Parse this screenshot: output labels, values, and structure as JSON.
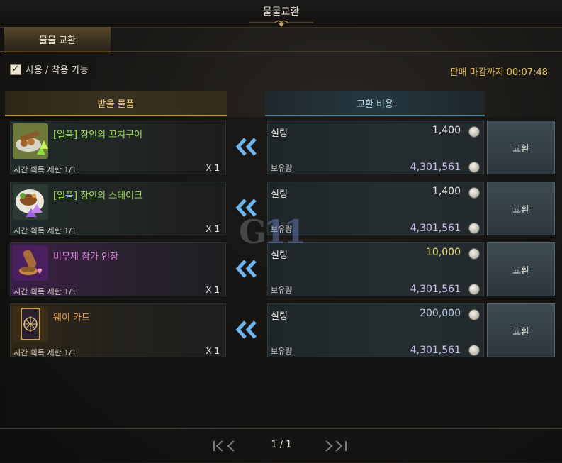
{
  "window": {
    "title": "물물교환"
  },
  "tabs": [
    {
      "label": "물물 교환",
      "active": true
    }
  ],
  "filter": {
    "label": "사용 / 착용 가능",
    "checked": true
  },
  "deadline": {
    "label": "판매 마감까지",
    "value": "00:07:48"
  },
  "columns": {
    "receive": "받을 물품",
    "cost": "교환 비용"
  },
  "rows": [
    {
      "item_name": "[일품] 장인의 꼬치구이",
      "name_color": "green",
      "icon": "skewer-food-icon",
      "limit": "시간 획득 제한 1/1",
      "qty": "X 1",
      "currency": "실링",
      "price": "1,400",
      "price_color": "white",
      "own_label": "보유량",
      "own": "4,301,561",
      "button": "교환"
    },
    {
      "item_name": "[일품] 장인의 스테이크",
      "name_color": "green",
      "icon": "steak-plate-icon",
      "limit": "시간 획득 제한 1/1",
      "qty": "X 1",
      "currency": "실링",
      "price": "1,400",
      "price_color": "white",
      "own_label": "보유량",
      "own": "4,301,561",
      "button": "교환"
    },
    {
      "item_name": "비무제 참가 인장",
      "name_color": "pink",
      "icon": "wax-seal-icon",
      "limit": "시간 획득 제한 1/1",
      "qty": "X 1",
      "currency": "실링",
      "price": "10,000",
      "price_color": "yellow",
      "own_label": "보유량",
      "own": "4,301,561",
      "button": "교환"
    },
    {
      "item_name": "웨이 카드",
      "name_color": "orange",
      "icon": "tarot-card-icon",
      "limit": "시간 획득 제한 1/1",
      "qty": "X 1",
      "currency": "실링",
      "price": "200,000",
      "price_color": "blue",
      "own_label": "보유량",
      "own": "4,301,561",
      "button": "교환"
    }
  ],
  "watermark": {
    "left": "G",
    "right": "11"
  },
  "pagination": {
    "first": "⫷",
    "prev": "‹",
    "current": "1 / 1",
    "next": "››",
    "last": "›|"
  },
  "colors": {
    "accent_gold": "#c9a25a",
    "deadline": "#e8c255",
    "green_item": "#9be04f",
    "pink_item": "#e78ae9",
    "orange_item": "#f0a24a"
  }
}
